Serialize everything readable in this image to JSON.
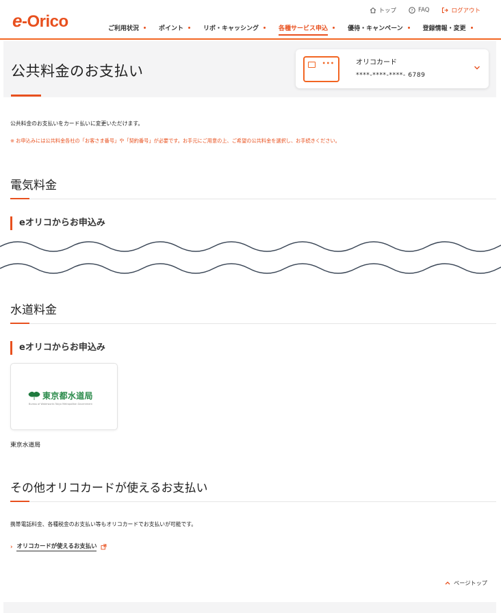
{
  "header": {
    "logo_e": "e",
    "logo_text": "-Orico",
    "utility": {
      "top": "トップ",
      "faq": "FAQ",
      "logout": "ログアウト"
    },
    "nav": [
      {
        "label": "ご利用状況"
      },
      {
        "label": "ポイント"
      },
      {
        "label": "リボ・キャッシング"
      },
      {
        "label": "各種サービス申込"
      },
      {
        "label": "優待・キャンペーン"
      },
      {
        "label": "登録情報・変更"
      }
    ]
  },
  "page": {
    "title": "公共料金のお支払い",
    "card": {
      "name": "オリコカード",
      "number": "****-****-****- 6789"
    },
    "intro": "公共料金のお支払いをカード払いに変更いただけます。",
    "notice": "※ お申込みには公共料金各社の「お客さま番号」や「契約番号」が必要です。お手元にご用意の上、ご希望の公共料金を選択し、お手続きください。"
  },
  "electricity": {
    "title": "電気料金",
    "subheading": "eオリコからお申込み"
  },
  "water": {
    "title": "水道料金",
    "subheading": "eオリコからお申込み",
    "provider": {
      "logo_text": "東京都水道局",
      "logo_sub": "Bureau of Waterworks Tokyo Metropolitan Government",
      "label": "東京水道局"
    }
  },
  "other": {
    "title": "その他オリコカードが使えるお支払い",
    "text": "携帯電話料金、各種税金のお支払い等もオリコカードでお支払いが可能です。",
    "link": "オリコカードが使えるお支払い"
  },
  "page_top": "ページトップ",
  "colors": {
    "accent": "#e8501e",
    "panel": "#f4f4f5",
    "wave": "#3a4656"
  }
}
